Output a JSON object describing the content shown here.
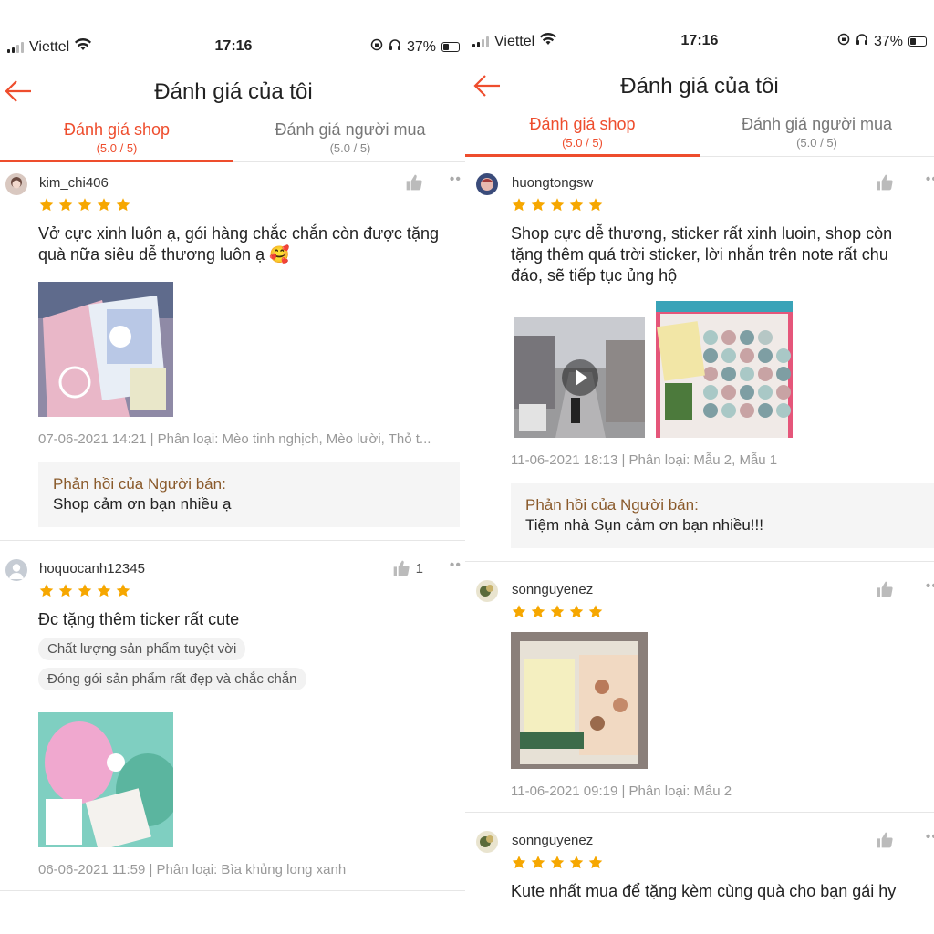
{
  "left": {
    "status": {
      "carrier": "Viettel",
      "time": "17:16",
      "battery": "37%"
    },
    "header": {
      "title": "Đánh giá của tôi"
    },
    "tabs": [
      {
        "label": "Đánh giá shop",
        "score": "(5.0 / 5)"
      },
      {
        "label": "Đánh giá người mua",
        "score": "(5.0 / 5)"
      }
    ],
    "reviews": [
      {
        "username": "kim_chi406",
        "text": "Vở cực xinh luôn ạ, gói hàng chắc chắn còn được tặng quà nữa siêu dễ thương luôn ạ 🥰",
        "meta": "07-06-2021 14:21 | Phân loại: Mèo tinh nghịch, Mèo lười, Thỏ t...",
        "reply_title": "Phản hồi của Người bán:",
        "reply_text": "Shop cảm ơn bạn nhiều ạ"
      },
      {
        "username": "hoquocanh12345",
        "likes": "1",
        "text": "Đc tặng thêm ticker rất cute",
        "tags": [
          "Chất lượng sản phẩm tuyệt vời",
          "Đóng gói sản phẩm rất đẹp và chắc chắn"
        ],
        "meta": "06-06-2021 11:59 | Phân loại: Bìa khủng long xanh"
      }
    ]
  },
  "right": {
    "status": {
      "carrier": "Viettel",
      "time": "17:16",
      "battery": "37%"
    },
    "header": {
      "title": "Đánh giá của tôi"
    },
    "tabs": [
      {
        "label": "Đánh giá shop",
        "score": "(5.0 / 5)"
      },
      {
        "label": "Đánh giá người mua",
        "score": "(5.0 / 5)"
      }
    ],
    "reviews": [
      {
        "username": "huongtongsw",
        "text": "Shop cực dễ thương, sticker rất xinh luoin, shop còn tặng thêm quá trời sticker, lời nhắn trên note rất chu đáo, sẽ tiếp tục ủng hộ",
        "meta": "11-06-2021 18:13 | Phân loại: Mẫu 2, Mẫu 1",
        "reply_title": "Phản hồi của Người bán:",
        "reply_text": "Tiệm nhà Sụn cảm ơn bạn nhiều!!!"
      },
      {
        "username": "sonnguyenez",
        "meta": "11-06-2021 09:19 | Phân loại: Mẫu 2"
      },
      {
        "username": "sonnguyenez",
        "text": "Kute nhất mua để tặng kèm cùng quà cho bạn gái hy"
      }
    ]
  },
  "colors": {
    "accent": "#ee4d2d",
    "star": "#f6a700",
    "reply_title": "#8a5a2b"
  }
}
